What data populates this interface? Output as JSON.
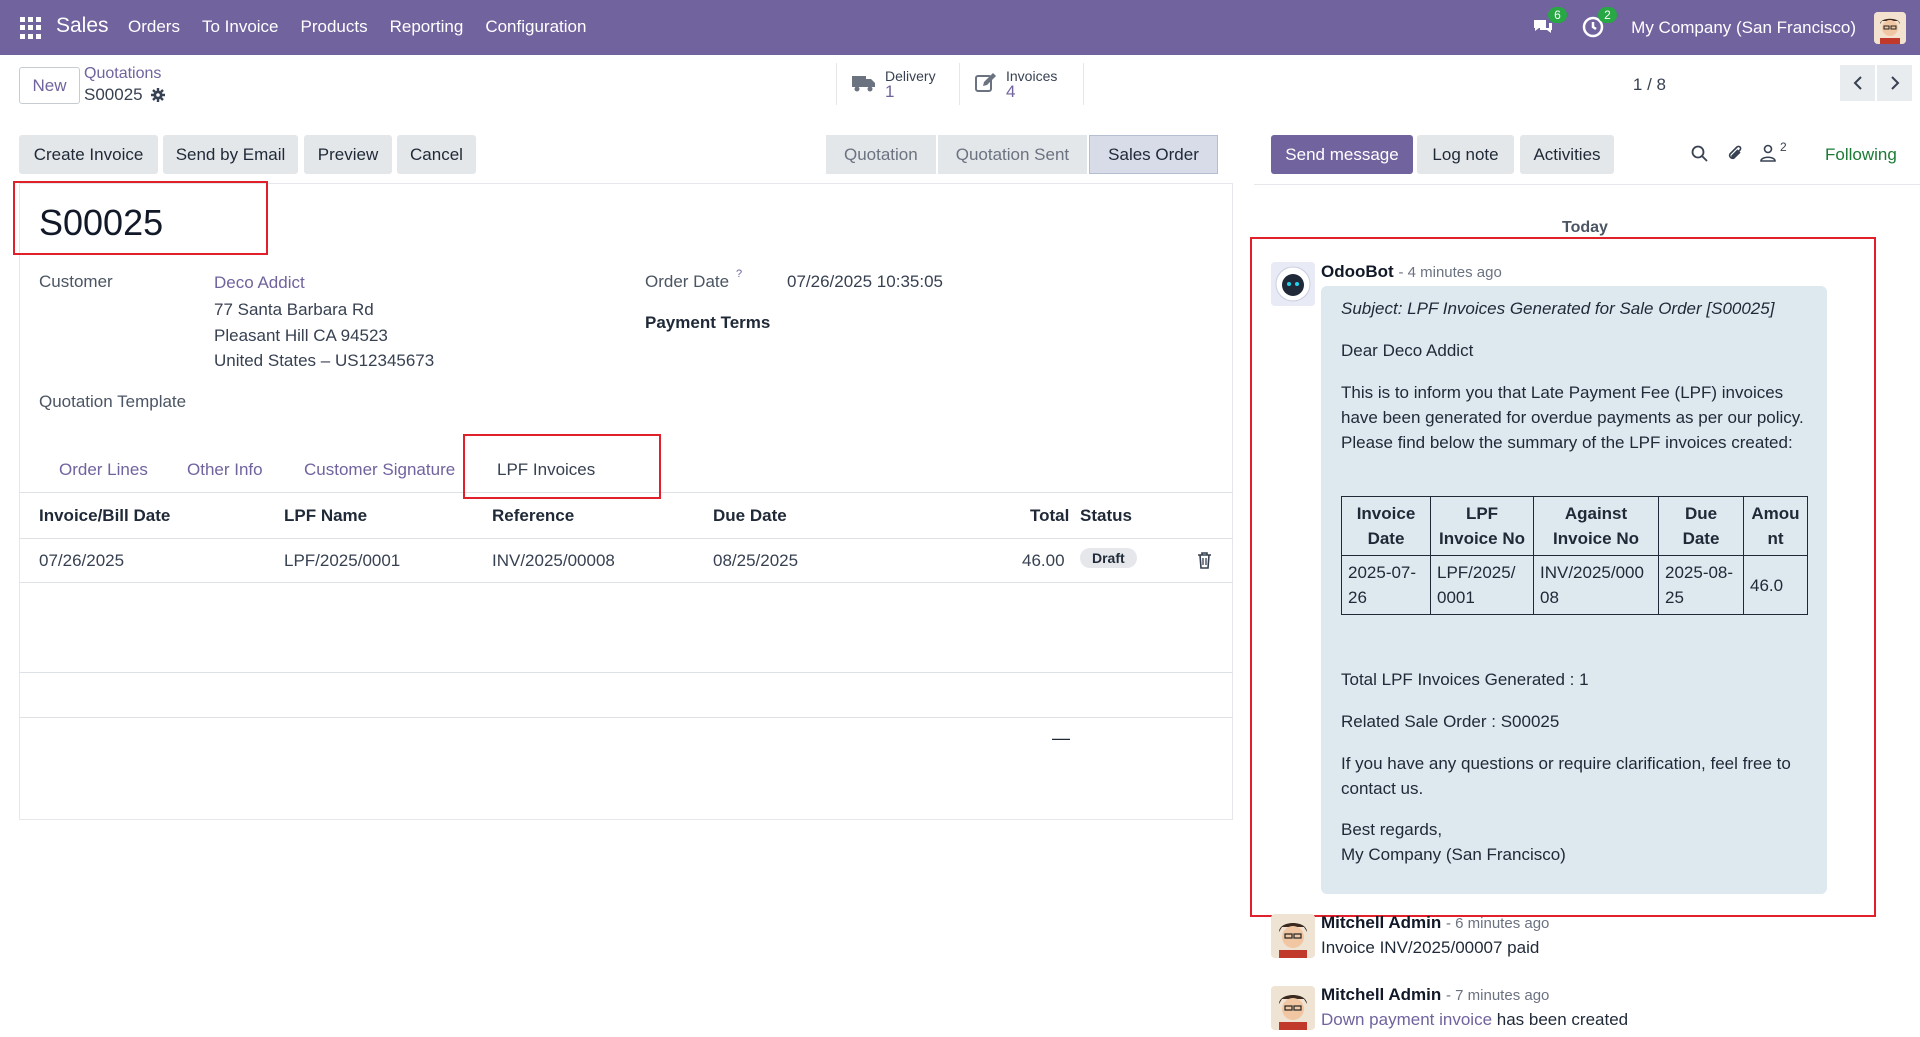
{
  "nav": {
    "brand": "Sales",
    "menu": [
      "Orders",
      "To Invoice",
      "Products",
      "Reporting",
      "Configuration"
    ],
    "chat_count": "6",
    "activity_count": "2",
    "company": "My Company (San Francisco)"
  },
  "control": {
    "new_label": "New",
    "breadcrumb_parent": "Quotations",
    "breadcrumb_current": "S00025",
    "smart_buttons": [
      {
        "label": "Delivery",
        "value": "1"
      },
      {
        "label": "Invoices",
        "value": "4"
      }
    ],
    "pager": "1 / 8"
  },
  "actions": [
    "Create Invoice",
    "Send by Email",
    "Preview",
    "Cancel"
  ],
  "statusbar": [
    "Quotation",
    "Quotation Sent",
    "Sales Order"
  ],
  "form": {
    "title": "S00025",
    "customer_label": "Customer",
    "customer_name": "Deco Addict",
    "address": [
      "77 Santa Barbara Rd",
      "Pleasant Hill CA 94523",
      "United States – US12345673"
    ],
    "order_date_label": "Order Date",
    "order_date_help": "?",
    "order_date": "07/26/2025 10:35:05",
    "payment_terms_label": "Payment Terms",
    "template_label": "Quotation Template"
  },
  "tabs": [
    "Order Lines",
    "Other Info",
    "Customer Signature",
    "LPF Invoices"
  ],
  "lpf_table": {
    "headers": [
      "Invoice/Bill Date",
      "LPF Name",
      "Reference",
      "Due Date",
      "Total",
      "Status"
    ],
    "rows": [
      {
        "date": "07/26/2025",
        "name": "LPF/2025/0001",
        "reference": "INV/2025/00008",
        "due": "08/25/2025",
        "total": "46.00",
        "status": "Draft"
      }
    ],
    "footer_total": "—"
  },
  "chatter": {
    "buttons": [
      "Send message",
      "Log note",
      "Activities"
    ],
    "followers": "2",
    "following": "Following",
    "today": "Today",
    "messages": [
      {
        "author": "OdooBot",
        "ago": "- 4 minutes ago",
        "subject": "Subject: LPF Invoices Generated for Sale Order [S00025]",
        "greeting": "Dear Deco Addict",
        "body": "This is to inform you that Late Payment Fee (LPF) invoices have been generated for overdue payments as per our policy. Please find below the summary of the LPF invoices created:",
        "table_headers": [
          "Invoice Date",
          "LPF Invoice No",
          "Against Invoice No",
          "Due Date",
          "Amou nt"
        ],
        "table_row": [
          "2025-07-26",
          "LPF/2025/ 0001",
          "INV/2025/000 08",
          "2025-08-25",
          "46.0"
        ],
        "total_line": "Total LPF Invoices Generated : 1",
        "related_line": "Related Sale Order : S00025",
        "questions": "If you have any questions or require clarification, feel free to contact us.",
        "regards": "Best regards,",
        "signature": "My Company (San Francisco)"
      },
      {
        "author": "Mitchell Admin",
        "ago": "- 6 minutes ago",
        "text": "Invoice INV/2025/00007 paid"
      },
      {
        "author": "Mitchell Admin",
        "ago": "- 7 minutes ago",
        "link": "Down payment invoice",
        "text": " has been created"
      }
    ]
  }
}
